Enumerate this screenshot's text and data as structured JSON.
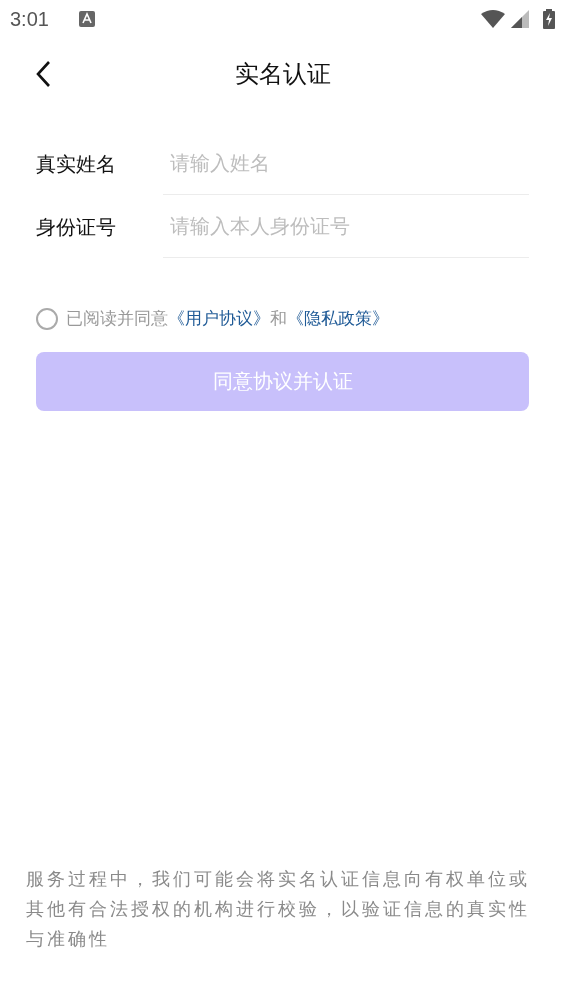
{
  "status_bar": {
    "time": "3:01"
  },
  "header": {
    "title": "实名认证"
  },
  "form": {
    "fields": [
      {
        "label": "真实姓名",
        "placeholder": "请输入姓名"
      },
      {
        "label": "身份证号",
        "placeholder": "请输入本人身份证号"
      }
    ]
  },
  "agreement": {
    "checked": false,
    "prefix": "已阅读并同意",
    "links": [
      "《用户协议》",
      "《隐私政策》"
    ],
    "joiner": "和"
  },
  "submit_button": {
    "label": "同意协议并认证",
    "disabled": true
  },
  "footer_note": "服务过程中，我们可能会将实名认证信息向有权单位或其他有合法授权的机构进行校验，以验证信息的真实性与准确性"
}
